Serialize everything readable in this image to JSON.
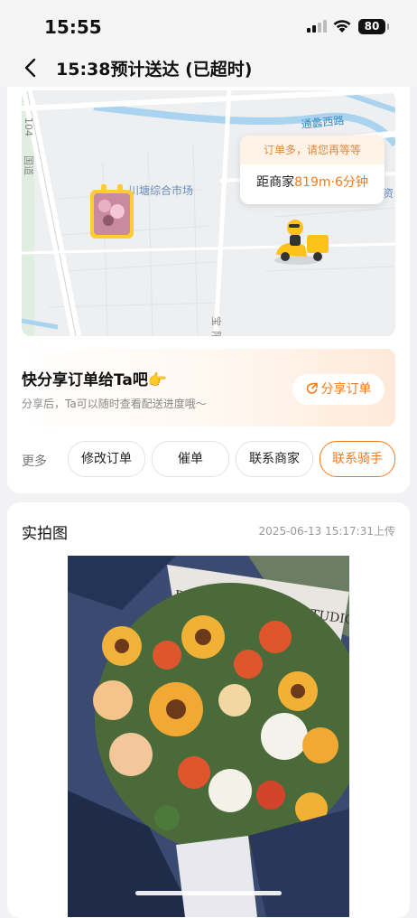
{
  "status_bar": {
    "time": "15:55",
    "battery": "80"
  },
  "header": {
    "title": "15:38预计送达 (已超时)"
  },
  "map": {
    "road_labels": [
      "通蠡西路",
      "川塘综合市场",
      "国道",
      "104",
      "宝",
      "阳",
      "兰资"
    ],
    "bubble_top": "订单多，请您再等等",
    "bubble_prefix": "距商家",
    "bubble_highlight": "819m·6分钟"
  },
  "share": {
    "title": "快分享订单给Ta吧👉",
    "subtitle": "分享后，Ta可以随时查看配送进度哦～",
    "button": "分享订单"
  },
  "actions": {
    "more": "更多",
    "items": [
      "修改订单",
      "催单",
      "联系商家",
      "联系骑手"
    ]
  },
  "photo": {
    "title": "实拍图",
    "time": "2025-06-13 15:17:31上传",
    "card_text": "PRETTY FLOWERS STUDIO"
  },
  "colors": {
    "accent": "#f27a1a",
    "map_bg": "#eeeff1",
    "water": "#a9d3ee"
  }
}
